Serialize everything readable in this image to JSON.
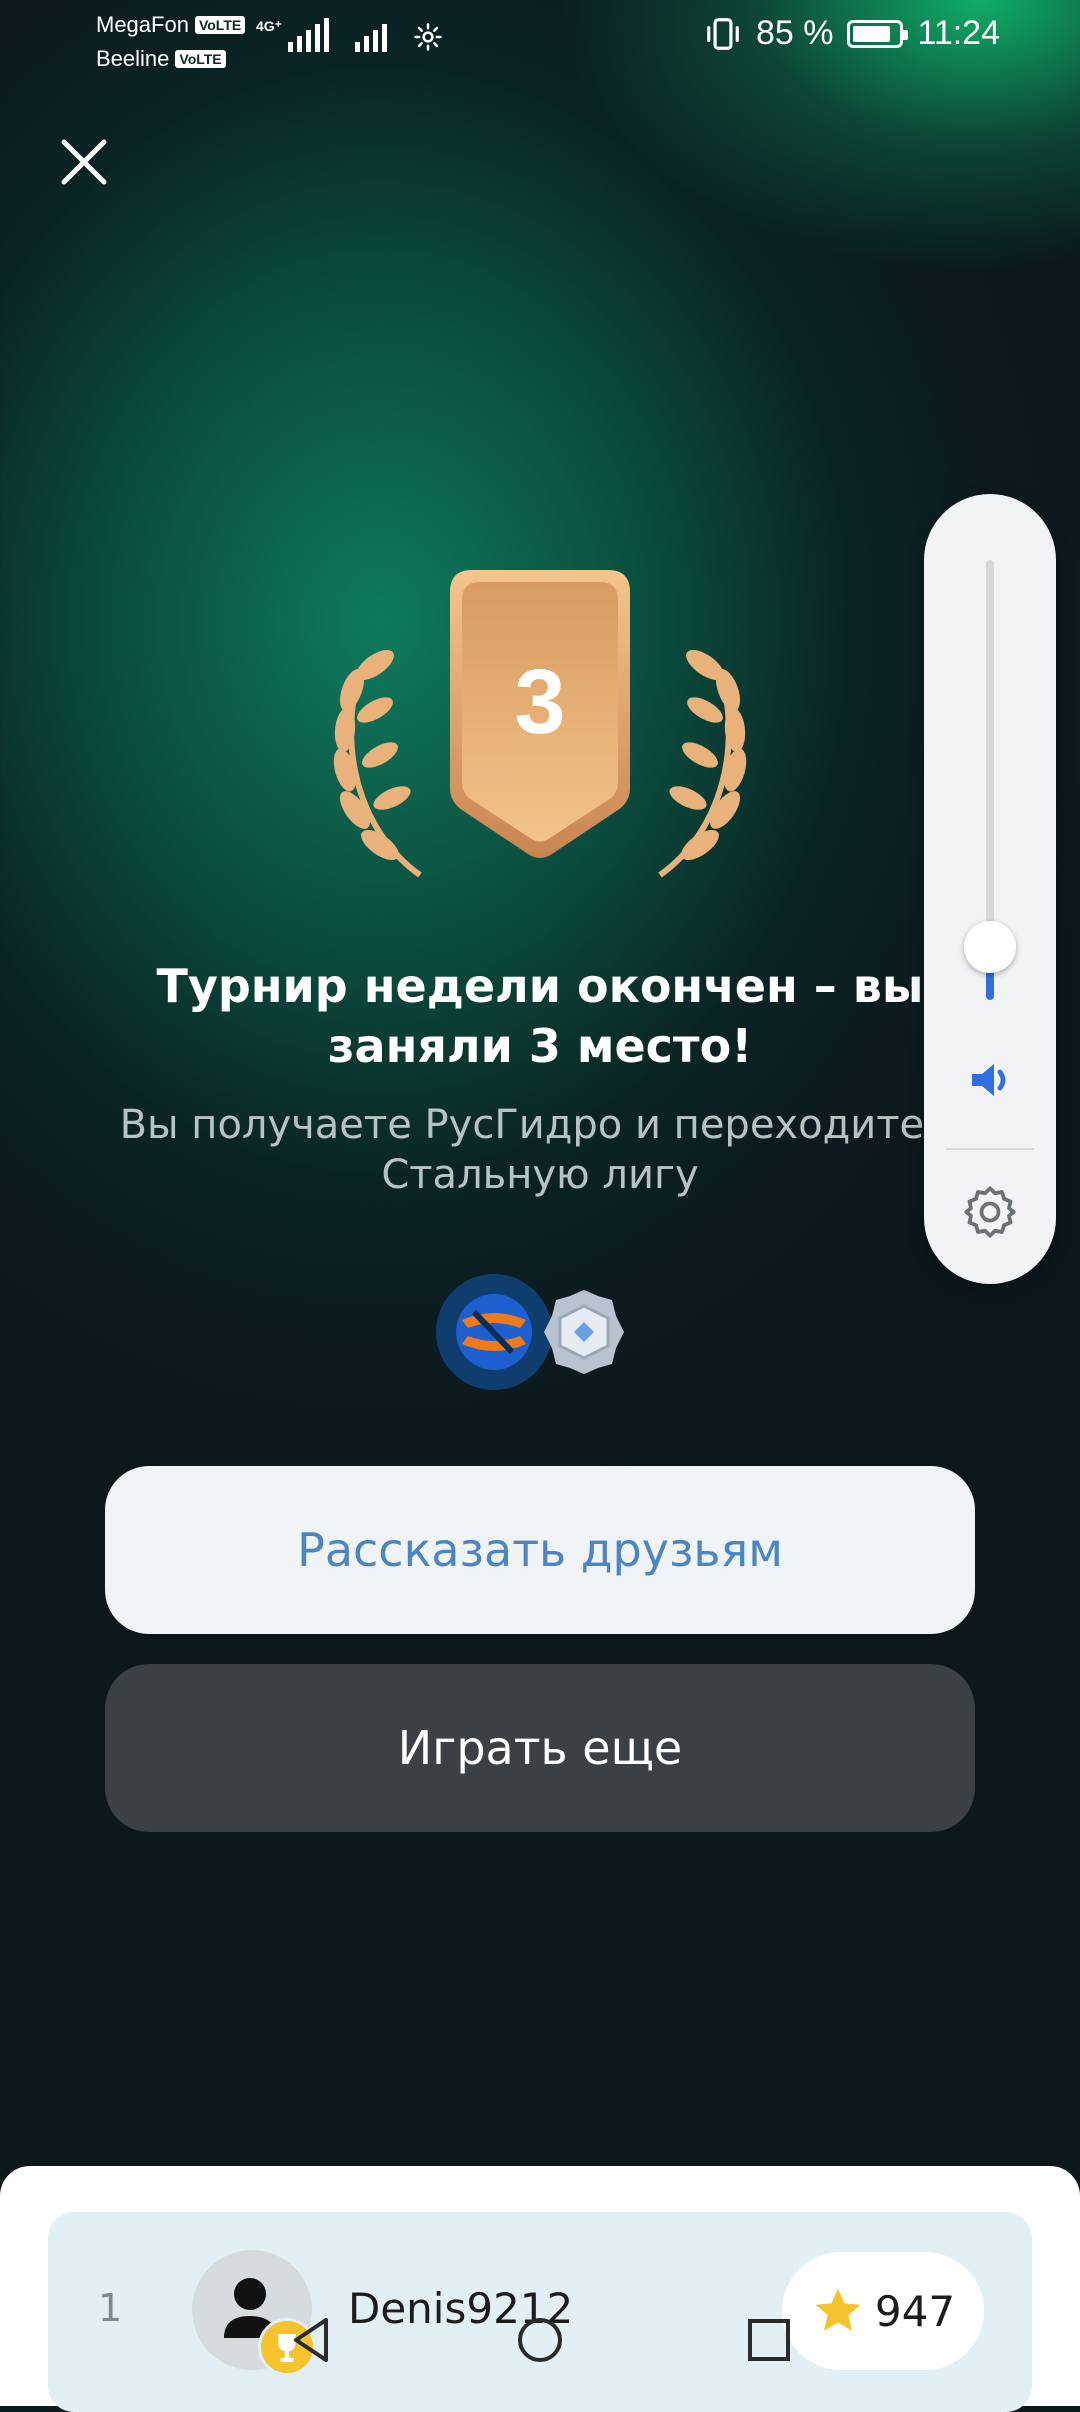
{
  "status_bar": {
    "carrier_1": "MegaFon",
    "carrier_2": "Beeline",
    "volte_label": "VoLTE",
    "network_type": "4G⁺",
    "battery_percent": "85 %",
    "battery_level": 0.85,
    "time": "11:24"
  },
  "close_icon": "close-icon",
  "result": {
    "place": "3",
    "title": "Турнир недели окончен – вы заняли 3 место!",
    "subtitle": "Вы получаете РусГидро и переходите в Стальную лигу"
  },
  "buttons": {
    "share_label": "Рассказать друзьям",
    "play_again_label": "Играть еще"
  },
  "volume_panel": {
    "level": 0.12,
    "speaker_icon": "speaker-icon",
    "settings_icon": "gear-icon"
  },
  "leaderboard": {
    "rows": [
      {
        "rank": "1",
        "username": "Denis9212",
        "score": "947"
      }
    ]
  },
  "colors": {
    "accent_blue": "#4a86c5",
    "volume_blue": "#2f6fe0",
    "bronze": "#e3a46a",
    "star": "#f5c32c"
  }
}
